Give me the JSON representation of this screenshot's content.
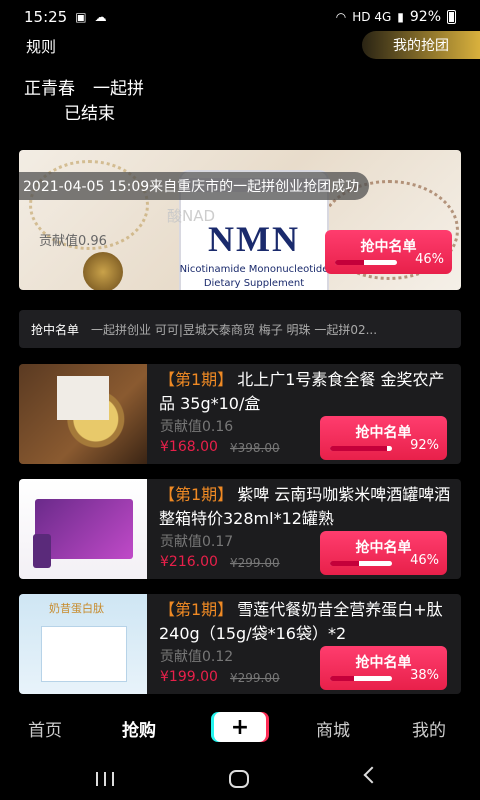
{
  "status_bar": {
    "time": "15:25",
    "network": "HD 4G",
    "battery": "92%"
  },
  "header": {
    "rules_label": "规则",
    "my_group_label": "我的抢团"
  },
  "brand": {
    "name": "正青春",
    "subtitle": "一起拼",
    "status": "已结束"
  },
  "hero": {
    "banner_text": "2021-04-05 15:09来自重庆市的一起拼创业抢团成功",
    "product_brand": "NMN",
    "product_sub1": "Nicotinamide Mononucleotide",
    "product_sub2": "Dietary Supplement",
    "acid_text": "酸NAD",
    "contribution": "贡献值0.96",
    "grab_label": "抢中名单",
    "progress_pct": "46%",
    "progress_value": 0.46
  },
  "winners": {
    "title": "抢中名单",
    "list": "一起拼创业 可可|昱城天泰商贸 梅子 明珠 一起拼02..."
  },
  "items": [
    {
      "period": "【第1期】",
      "title": "北上广1号素食全餐 金奖农产品 35g*10/盒",
      "contribution": "贡献值0.16",
      "price": "¥168.00",
      "original_price": "¥398.00",
      "grab_label": "抢中名单",
      "progress_pct": "92%",
      "progress_value": 0.92
    },
    {
      "period": "【第1期】",
      "title": "紫啤 云南玛咖紫米啤酒罐啤酒整箱特价328ml*12罐熟",
      "contribution": "贡献值0.17",
      "price": "¥216.00",
      "original_price": "¥299.00",
      "grab_label": "抢中名单",
      "progress_pct": "46%",
      "progress_value": 0.46
    },
    {
      "period": "【第1期】",
      "title": "雪莲代餐奶昔全营养蛋白+肽240g（15g/袋*16袋）*2",
      "contribution": "贡献值0.12",
      "price": "¥199.00",
      "original_price": "¥299.00",
      "grab_label": "抢中名单",
      "progress_pct": "38%",
      "progress_value": 0.38,
      "image_label": "奶昔蛋白肽"
    }
  ],
  "tabbar": {
    "home": "首页",
    "grab": "抢购",
    "plus": "+",
    "mall": "商城",
    "mine": "我的"
  }
}
